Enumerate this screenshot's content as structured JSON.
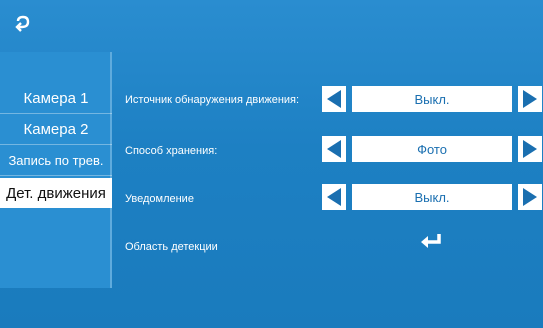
{
  "sidebar": {
    "items": [
      {
        "label": "Камера 1"
      },
      {
        "label": "Камера 2"
      },
      {
        "label": "Запись по трев."
      },
      {
        "label": "Дет. движения"
      }
    ]
  },
  "settings": {
    "source": {
      "label": "Источник обнаружения движения:",
      "value": "Выкл."
    },
    "storage": {
      "label": "Способ хранения:",
      "value": "Фото"
    },
    "notification": {
      "label": "Уведомление",
      "value": "Выкл."
    },
    "detection_area": {
      "label": "Область детекции"
    }
  },
  "icons": {
    "back": "back-arrow-icon",
    "enter": "enter-arrow-icon",
    "left": "triangle-left-icon",
    "right": "triangle-right-icon"
  },
  "colors": {
    "background": "#1f83c6",
    "active_tab": "#ffffff",
    "value_text": "#1a6fb0"
  }
}
